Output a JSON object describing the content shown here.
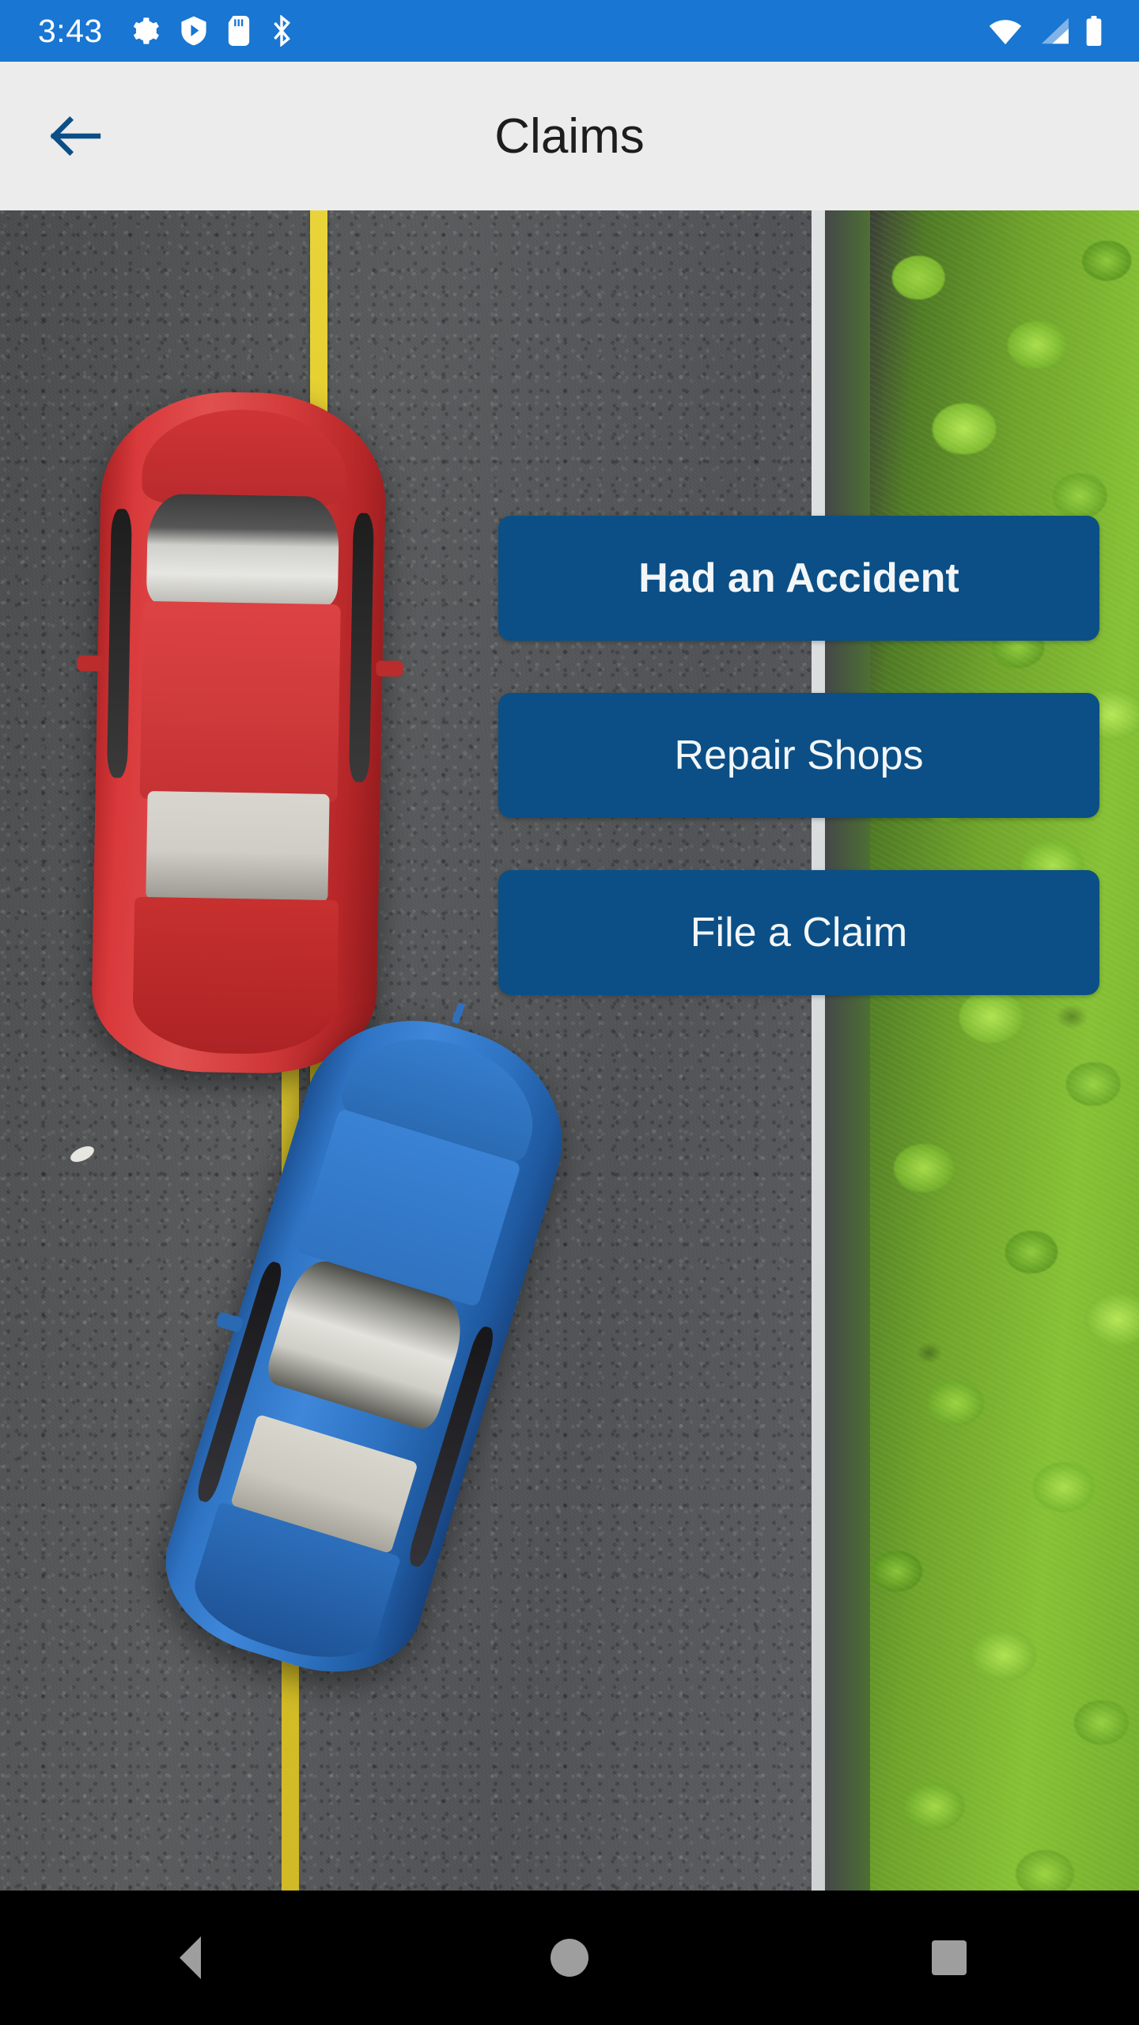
{
  "status_bar": {
    "time": "3:43",
    "background_color": "#1976d2",
    "left_icons": [
      "gear-icon",
      "play-protect-icon",
      "sd-card-icon",
      "bluetooth-icon"
    ],
    "right_icons": [
      "wifi-icon",
      "cellular-signal-icon",
      "battery-icon"
    ]
  },
  "app_bar": {
    "title": "Claims",
    "back_label": "back-arrow",
    "background_color": "#ececec",
    "accent_color": "#0b4f86"
  },
  "content": {
    "background_description": "Aerial photo of a car accident: a red sedan and a blue sedan collided on asphalt road with a yellow centre line, white shoulder line and green trees on the right",
    "buttons": [
      {
        "label": "Had an Accident",
        "emphasis": "bold",
        "color": "#0b4f86"
      },
      {
        "label": "Repair Shops",
        "emphasis": "regular",
        "color": "#0b4f86"
      },
      {
        "label": "File a Claim",
        "emphasis": "regular",
        "color": "#0b4f86"
      }
    ]
  },
  "nav_bar": {
    "background_color": "#000000",
    "items": [
      "back-triangle-icon",
      "home-circle-icon",
      "recents-square-icon"
    ]
  }
}
